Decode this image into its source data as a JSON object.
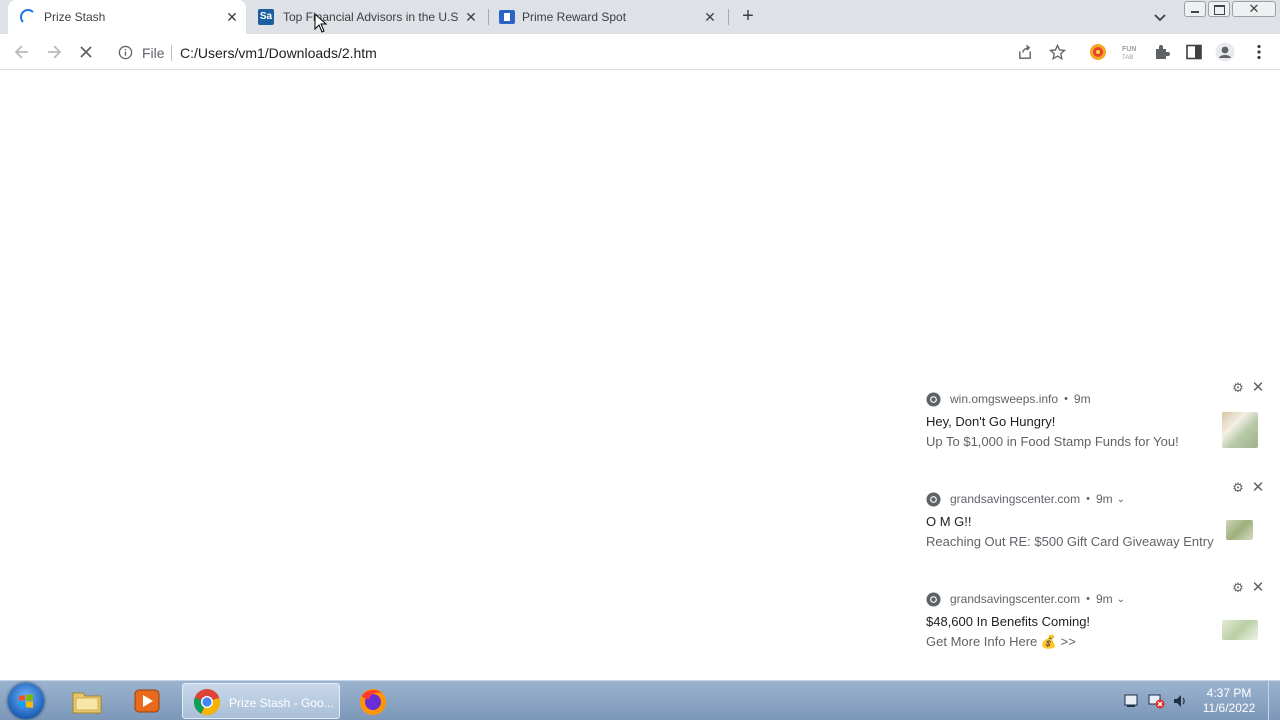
{
  "browser": {
    "tabs": [
      {
        "title": "Prize Stash",
        "active": true,
        "loading": true
      },
      {
        "title": "Top Financial Advisors in the U.S.",
        "favicon_text": "Sa",
        "active": false
      },
      {
        "title": "Prime Reward Spot",
        "active": false
      }
    ],
    "close_glyph": "✕",
    "new_tab_glyph": "+",
    "address": {
      "scheme_label": "File",
      "url": "C:/Users/vm1/Downloads/2.htm"
    },
    "window_close_glyph": "✕"
  },
  "notifications": [
    {
      "source": "win.omgsweeps.info",
      "age": "9m",
      "has_chevron": false,
      "title": "Hey, Don't Go Hungry!",
      "body": "Up To $1,000 in Food Stamp Funds for You!",
      "thumb_icon": "food-thumbnail"
    },
    {
      "source": "grandsavingscenter.com",
      "age": "9m",
      "has_chevron": true,
      "title": "O M G!!",
      "body": "Reaching Out RE: $500 Gift Card Giveaway Entry",
      "thumb_icon": "gift-card-thumbnail"
    },
    {
      "source": "grandsavingscenter.com",
      "age": "9m",
      "has_chevron": true,
      "title": " $48,600 In Benefits Coming!",
      "body": " Get More Info Here 💰 >>",
      "thumb_icon": "money-thumbnail"
    }
  ],
  "notification_separator": "•",
  "notification_chevron": "⌄",
  "notification_gear": "⚙",
  "notification_close": "✕",
  "taskbar": {
    "apps": [
      {
        "name": "explorer",
        "icon": "folder-icon"
      },
      {
        "name": "media-player",
        "icon": "media-player-icon"
      },
      {
        "name": "chrome",
        "icon": "chrome-icon",
        "label": "Prize Stash - Goo...",
        "active": true
      },
      {
        "name": "firefox",
        "icon": "firefox-icon"
      }
    ],
    "clock": {
      "time": "4:37 PM",
      "date": "11/6/2022"
    }
  },
  "colors": {
    "tab_strip": "#dee1e6",
    "accent": "#1a73e8",
    "taskbar": "#8aa4c4"
  }
}
